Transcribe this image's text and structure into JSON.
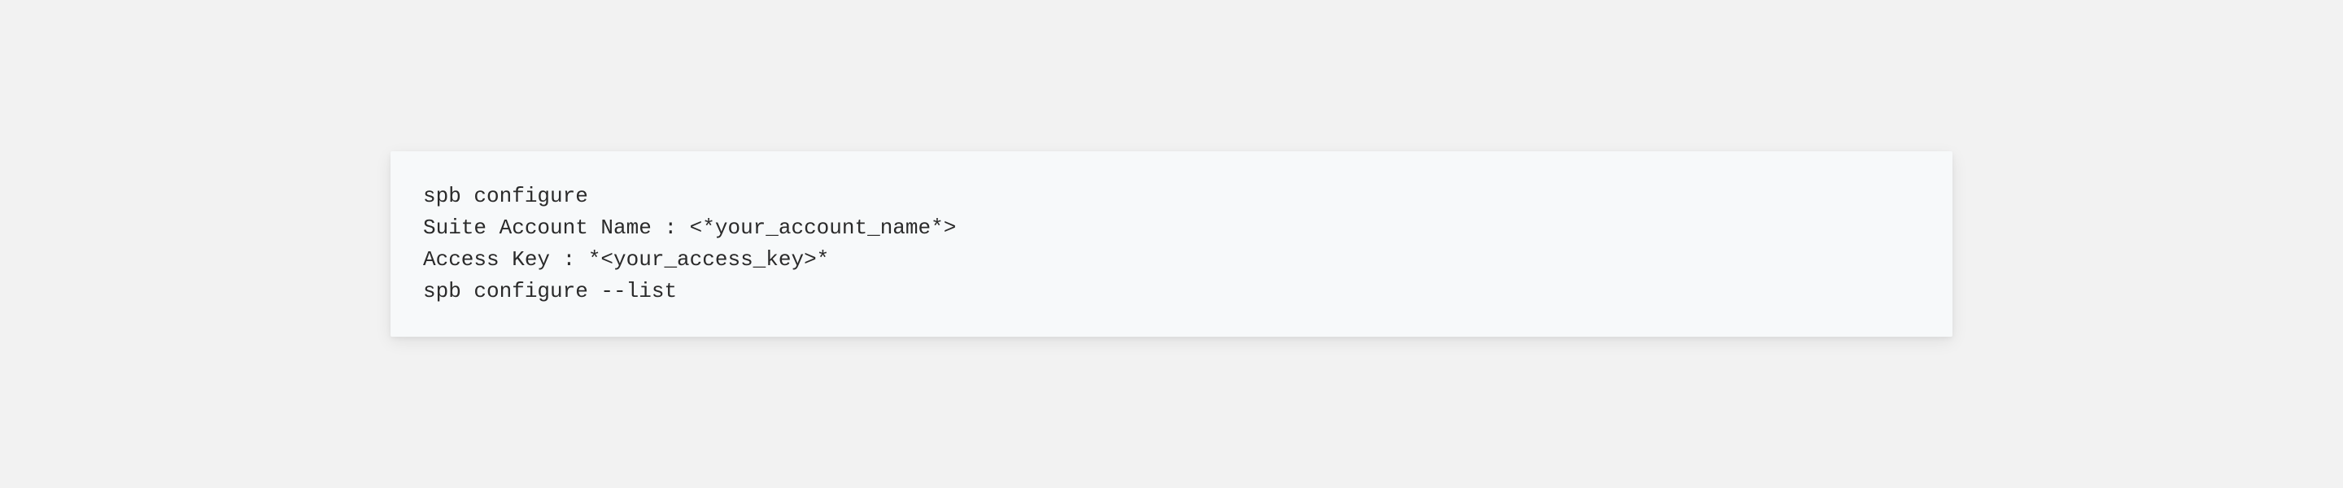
{
  "code": {
    "lines": [
      "spb configure",
      "Suite Account Name : <*your_account_name*>",
      "Access Key : *<your_access_key>*",
      "spb configure --list"
    ]
  }
}
